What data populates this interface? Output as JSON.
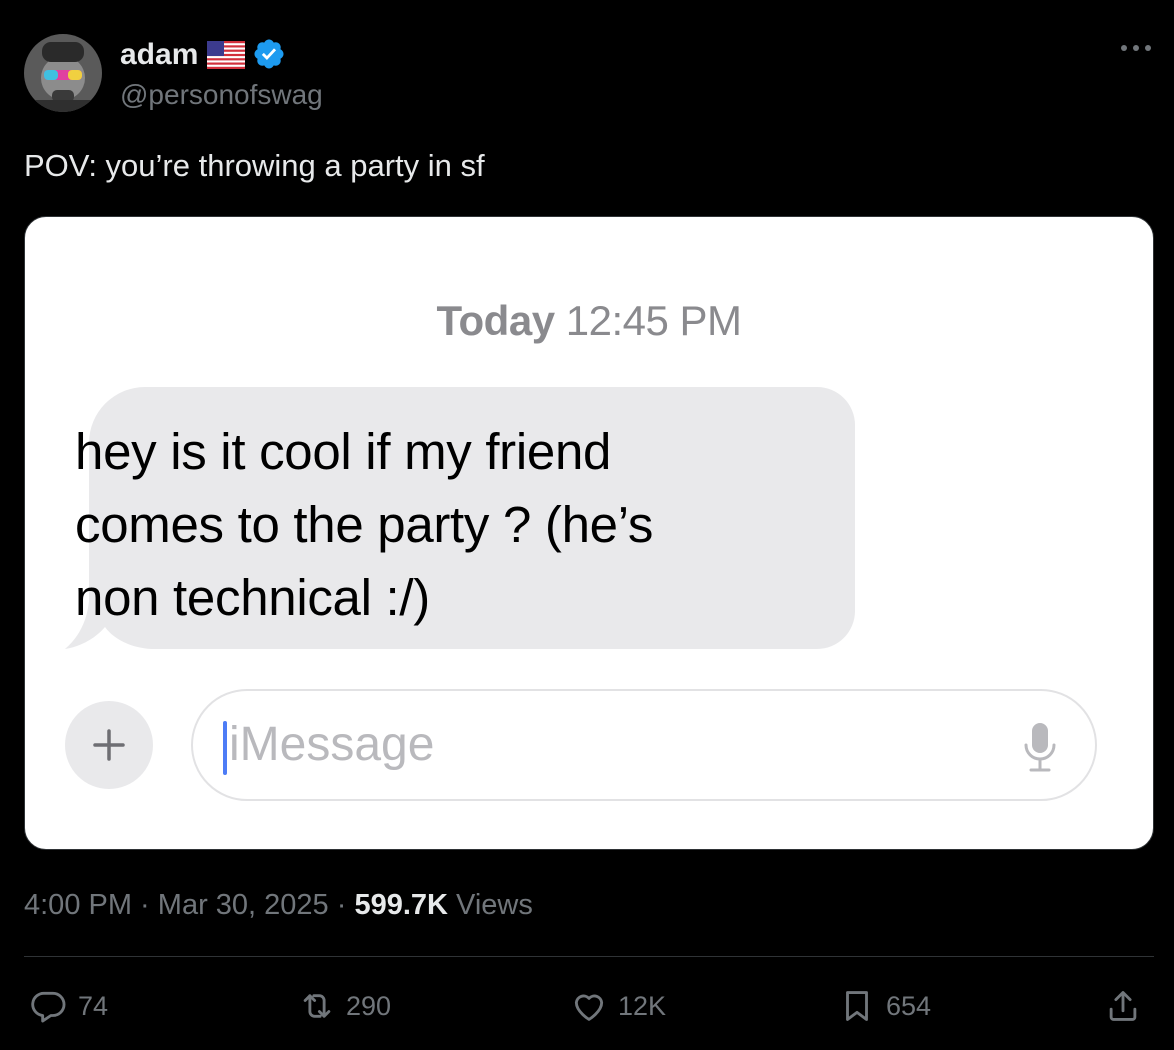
{
  "author": {
    "name": "adam",
    "handle": "@personofswag"
  },
  "tweet": {
    "text": "POV: you’re throwing a party in sf"
  },
  "media": {
    "timestamp_day": "Today",
    "timestamp_time": "12:45 PM",
    "message_line1": "hey is it cool if my friend",
    "message_line2": "comes to the party ? (he’s",
    "message_line3": "non technical :/)",
    "input_placeholder": "iMessage",
    "plus_label": "+"
  },
  "meta": {
    "time": "4:00 PM",
    "sep1": " · ",
    "date": "Mar 30, 2025",
    "sep2": " · ",
    "views_count": "599.7K",
    "views_label": " Views"
  },
  "actions": {
    "replies": "74",
    "reposts": "290",
    "likes": "12K",
    "bookmarks": "654"
  },
  "colors": {
    "background": "#000000",
    "verified": "#1d9bf0",
    "secondary_text": "#71767b",
    "bubble": "#e9e9eb"
  }
}
